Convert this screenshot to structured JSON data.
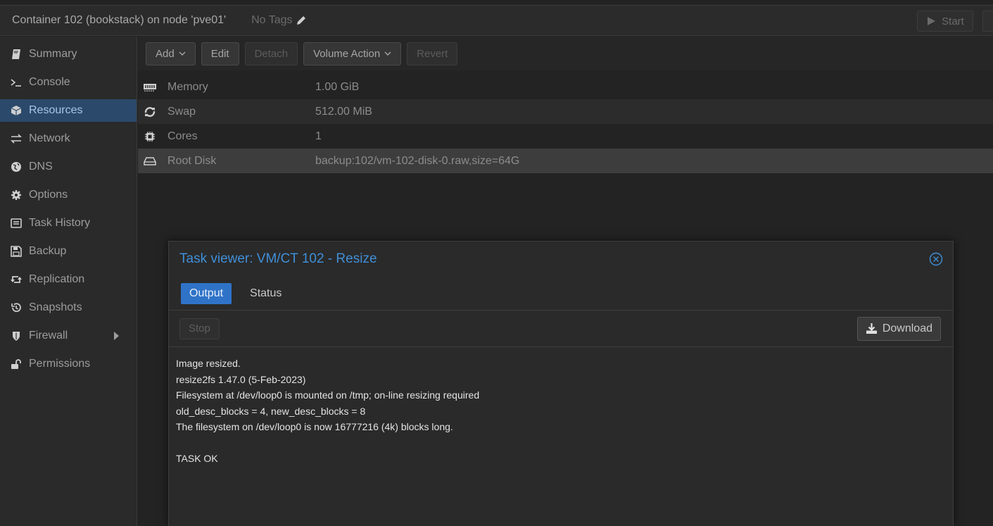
{
  "header": {
    "title": "Container 102 (bookstack) on node 'pve01'",
    "tags_label": "No Tags",
    "start_label": "Start"
  },
  "sidebar": {
    "items": [
      {
        "label": "Summary",
        "icon": "book-icon"
      },
      {
        "label": "Console",
        "icon": "terminal-icon"
      },
      {
        "label": "Resources",
        "icon": "cube-icon",
        "active": true
      },
      {
        "label": "Network",
        "icon": "exchange-icon"
      },
      {
        "label": "DNS",
        "icon": "globe-icon"
      },
      {
        "label": "Options",
        "icon": "gear-icon"
      },
      {
        "label": "Task History",
        "icon": "list-icon"
      },
      {
        "label": "Backup",
        "icon": "floppy-icon"
      },
      {
        "label": "Replication",
        "icon": "retweet-icon"
      },
      {
        "label": "Snapshots",
        "icon": "history-icon"
      },
      {
        "label": "Firewall",
        "icon": "shield-icon",
        "expandable": true
      },
      {
        "label": "Permissions",
        "icon": "unlock-icon"
      }
    ]
  },
  "toolbar": {
    "add_label": "Add",
    "edit_label": "Edit",
    "detach_label": "Detach",
    "volume_action_label": "Volume Action",
    "revert_label": "Revert"
  },
  "resources": [
    {
      "name": "Memory",
      "value": "1.00 GiB",
      "icon": "memory-icon"
    },
    {
      "name": "Swap",
      "value": "512.00 MiB",
      "icon": "refresh-icon"
    },
    {
      "name": "Cores",
      "value": "1",
      "icon": "cpu-icon"
    },
    {
      "name": "Root Disk",
      "value": "backup:102/vm-102-disk-0.raw,size=64G",
      "icon": "hdd-icon"
    }
  ],
  "task_viewer": {
    "title": "Task viewer: VM/CT 102 - Resize",
    "tabs": [
      "Output",
      "Status"
    ],
    "stop_label": "Stop",
    "download_label": "Download",
    "output_lines": [
      "Image resized.",
      "resize2fs 1.47.0 (5-Feb-2023)",
      "Filesystem at /dev/loop0 is mounted on /tmp; on-line resizing required",
      "old_desc_blocks = 4, new_desc_blocks = 8",
      "The filesystem on /dev/loop0 is now 16777216 (4k) blocks long.",
      "",
      "TASK OK"
    ]
  },
  "colors": {
    "accent": "#3f8fd8",
    "active_tab": "#2f73c8",
    "sidebar_active": "#2b4a6b"
  }
}
